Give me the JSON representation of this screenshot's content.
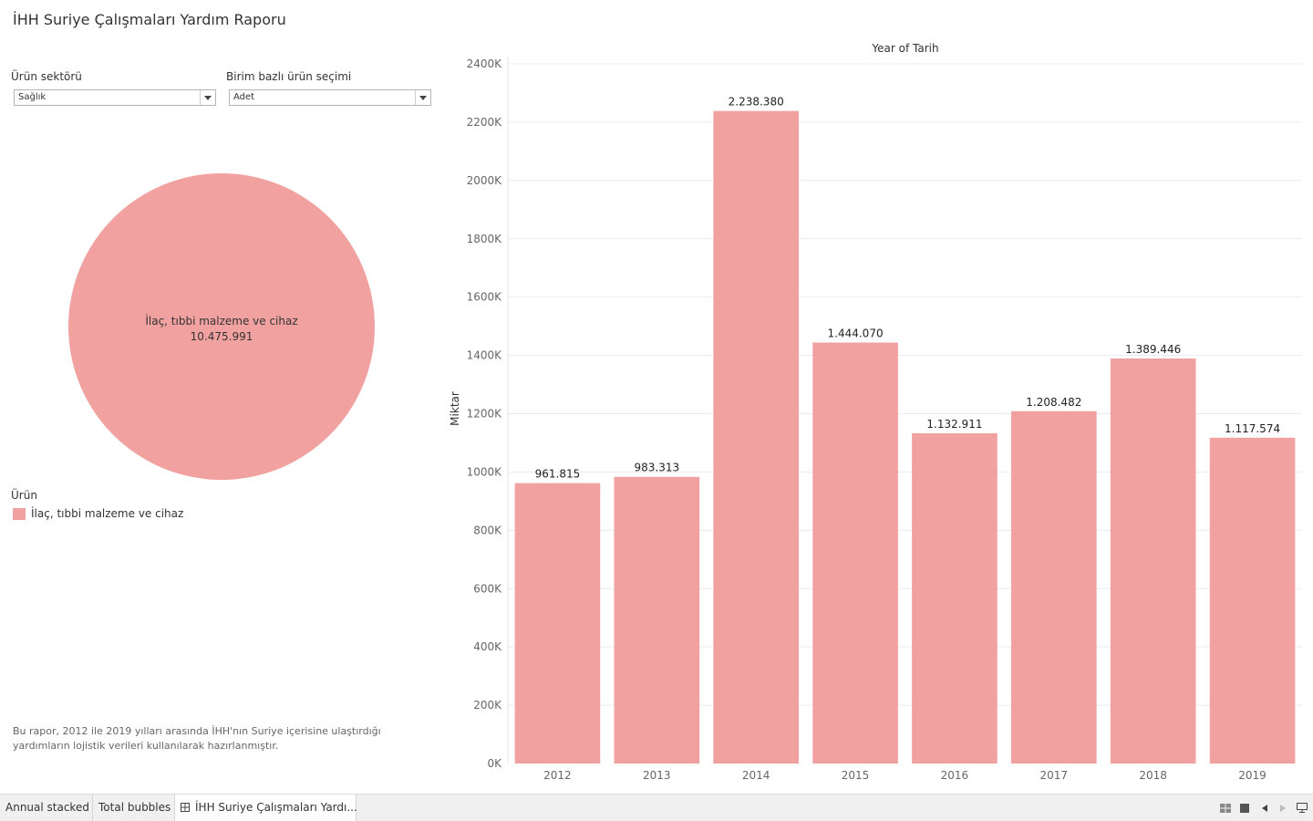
{
  "dashboard": {
    "title": "İHH Suriye Çalışmaları Yardım Raporu",
    "footnote": "Bu rapor, 2012 ile 2019 yılları arasında İHH'nın Suriye içerisine ulaştırdığı yardımların lojistik verileri kullanılarak hazırlanmıştır."
  },
  "filters": {
    "sector": {
      "label": "Ürün sektörü",
      "value": "Sağlık"
    },
    "unit": {
      "label": "Birim bazlı ürün seçimi",
      "value": "Adet"
    }
  },
  "bubble": {
    "label": "İlaç, tıbbi malzeme ve cihaz",
    "value": "10.475.991",
    "color": "#f1a19f"
  },
  "legend": {
    "title": "Ürün",
    "items": [
      {
        "label": "İlaç, tıbbi malzeme ve cihaz",
        "color": "#f1a19f"
      }
    ]
  },
  "chart_data": {
    "type": "bar",
    "title": "Year of Tarih",
    "xlabel": "",
    "ylabel": "Miktar",
    "categories": [
      "2012",
      "2013",
      "2014",
      "2015",
      "2016",
      "2017",
      "2018",
      "2019"
    ],
    "values": [
      961815,
      983313,
      2238380,
      1444070,
      1132911,
      1208482,
      1389446,
      1117574
    ],
    "value_labels": [
      "961.815",
      "983.313",
      "2.238.380",
      "1.444.070",
      "1.132.911",
      "1.208.482",
      "1.389.446",
      "1.117.574"
    ],
    "ylim": [
      0,
      2400000
    ],
    "yticks": [
      0,
      200000,
      400000,
      600000,
      800000,
      1000000,
      1200000,
      1400000,
      1600000,
      1800000,
      2000000,
      2200000,
      2400000
    ],
    "ytick_labels": [
      "0K",
      "200K",
      "400K",
      "600K",
      "800K",
      "1000K",
      "1200K",
      "1400K",
      "1600K",
      "1800K",
      "2000K",
      "2200K",
      "2400K"
    ],
    "color": "#f1a19f",
    "grid": true
  },
  "tabs": [
    {
      "label": "Annual stacked",
      "active": false
    },
    {
      "label": "Total bubbles",
      "active": false
    },
    {
      "label": "İHH Suriye Çalışmaları Yardı...",
      "active": true
    }
  ],
  "controls": {
    "icons": [
      "grid-view-icon",
      "single-view-icon",
      "scroll-left-icon",
      "scroll-right-icon",
      "presentation-icon"
    ]
  }
}
